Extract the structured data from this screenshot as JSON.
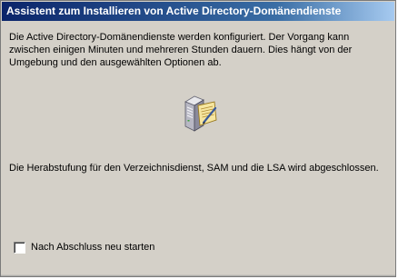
{
  "window": {
    "title": "Assistent zum Installieren von Active Directory-Domänendienste"
  },
  "content": {
    "intro_text": "Die Active Directory-Domänendienste werden konfiguriert. Der Vorgang kann zwischen einigen Minuten und mehreren Stunden dauern. Dies hängt von der Umgebung und den ausgewählten Optionen ab.",
    "icon": "server-with-document-icon",
    "status_text": "Die Herabstufung für den Verzeichnisdienst, SAM und die LSA wird abgeschlossen."
  },
  "options": {
    "restart_label": "Nach Abschluss neu starten",
    "restart_checked": false
  },
  "colors": {
    "title_gradient_start": "#0a246a",
    "title_gradient_end": "#a6caf0",
    "dialog_background": "#d4d0c8"
  }
}
